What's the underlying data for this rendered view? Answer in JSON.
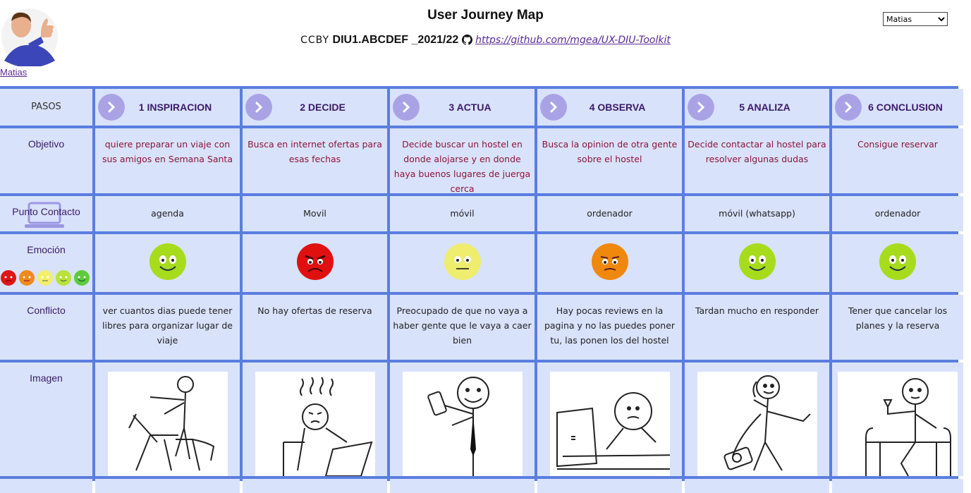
{
  "header": {
    "title": "User Journey Map",
    "cc_label": "CCBY",
    "course": "DIU1.ABCDEF _2021/22",
    "repo_link": "https://github.com/mgea/UX-DIU-Toolkit",
    "user_name": "Matias",
    "selected_user": "Matias"
  },
  "rows": {
    "pasos": "PASOS",
    "objetivo": "Objetivo",
    "contacto": "Punto Contacto",
    "emocion": "Emoción",
    "conflicto": "Conflicto",
    "imagen": "Imagen"
  },
  "steps": [
    {
      "label": "1 INSPIRACION",
      "objetivo": "quiere preparar un viaje con sus amigos en Semana Santa",
      "contacto": "agenda",
      "emocion": "happy",
      "conflicto": "ver cuantos dias puede tener libres para organizar lugar de viaje",
      "imagen": "stick-figure-pointing-icon"
    },
    {
      "label": "2 DECIDE",
      "objetivo": "Busca en internet ofertas para esas fechas",
      "contacto": "Movil",
      "emocion": "angry",
      "conflicto": "No hay ofertas de reserva",
      "imagen": "stick-figure-frustrated-laptop-icon"
    },
    {
      "label": "3 ACTUA",
      "objetivo": "Decide buscar un hostel en donde alojarse y en donde haya buenos lugares de juerga cerca",
      "contacto": "móvil",
      "emocion": "neutral",
      "conflicto": "Preocupado de que no vaya a haber gente que le vaya a caer bien",
      "imagen": "stick-figure-phone-icon"
    },
    {
      "label": "4 OBSERVA",
      "objetivo": "Busca la opinion de otra gente sobre el hostel",
      "contacto": "ordenador",
      "emocion": "annoyed",
      "conflicto": "Hay pocas reviews en la pagina y no las puedes poner tu, las ponen los del hostel",
      "imagen": "stick-figure-computer-icon"
    },
    {
      "label": "5 ANALIZA",
      "objetivo": "Decide contactar al hostel para resolver algunas dudas",
      "contacto": "móvil (whatsapp)",
      "emocion": "happy",
      "conflicto": "Tardan mucho en responder",
      "imagen": "stick-figure-telephone-icon"
    },
    {
      "label": "6 CONCLUSION",
      "objetivo": "Consigue reservar",
      "contacto": "ordenador",
      "emocion": "happy",
      "conflicto": "Tener que cancelar los planes y la reserva",
      "imagen": "stick-figure-relaxing-icon"
    }
  ],
  "colors": {
    "grid_border": "#5a7ee0",
    "cell_bg": "#d9e2fb",
    "objetivo_text": "#8a1538",
    "chevron": "#a9a3e6"
  }
}
